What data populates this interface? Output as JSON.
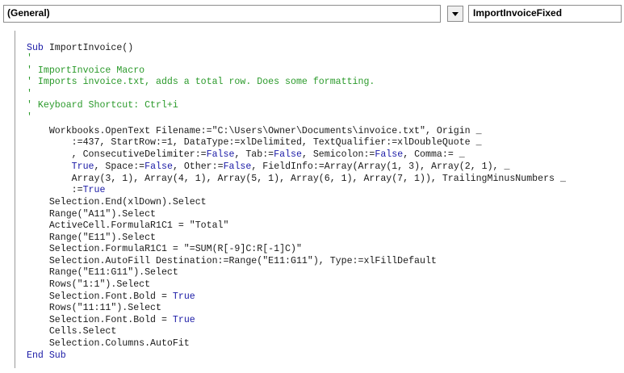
{
  "toolbar": {
    "object_value": "(General)",
    "procedure_value": "ImportInvoiceFixed"
  },
  "code": {
    "l1_kw": "Sub",
    "l1_rest": " ImportInvoice()",
    "l2": "'",
    "l3": "' ImportInvoice Macro",
    "l4": "' Imports invoice.txt, adds a total row. Does some formatting.",
    "l5": "'",
    "l6": "' Keyboard Shortcut: Ctrl+i",
    "l7": "'",
    "l8": "    Workbooks.OpenText Filename:=\"C:\\Users\\Owner\\Documents\\invoice.txt\", Origin _",
    "l9": "        :=437, StartRow:=1, DataType:=xlDelimited, TextQualifier:=xlDoubleQuote _",
    "l10_a": "        , ConsecutiveDelimiter:=",
    "l10_k1": "False",
    "l10_b": ", Tab:=",
    "l10_k2": "False",
    "l10_c": ", Semicolon:=",
    "l10_k3": "False",
    "l10_d": ", Comma:= _",
    "l11_a": "        ",
    "l11_k1": "True",
    "l11_b": ", Space:=",
    "l11_k2": "False",
    "l11_c": ", Other:=",
    "l11_k3": "False",
    "l11_d": ", FieldInfo:=Array(Array(1, 3), Array(2, 1), _",
    "l12": "        Array(3, 1), Array(4, 1), Array(5, 1), Array(6, 1), Array(7, 1)), TrailingMinusNumbers _",
    "l13_a": "        :=",
    "l13_k": "True",
    "l14": "    Selection.End(xlDown).Select",
    "l15": "    Range(\"A11\").Select",
    "l16": "    ActiveCell.FormulaR1C1 = \"Total\"",
    "l17": "    Range(\"E11\").Select",
    "l18": "    Selection.FormulaR1C1 = \"=SUM(R[-9]C:R[-1]C)\"",
    "l19": "    Selection.AutoFill Destination:=Range(\"E11:G11\"), Type:=xlFillDefault",
    "l20": "    Range(\"E11:G11\").Select",
    "l21": "    Rows(\"1:1\").Select",
    "l22_a": "    Selection.Font.Bold = ",
    "l22_k": "True",
    "l23": "    Rows(\"11:11\").Select",
    "l24_a": "    Selection.Font.Bold = ",
    "l24_k": "True",
    "l25": "    Cells.Select",
    "l26": "    Selection.Columns.AutoFit",
    "l27": "End Sub"
  }
}
